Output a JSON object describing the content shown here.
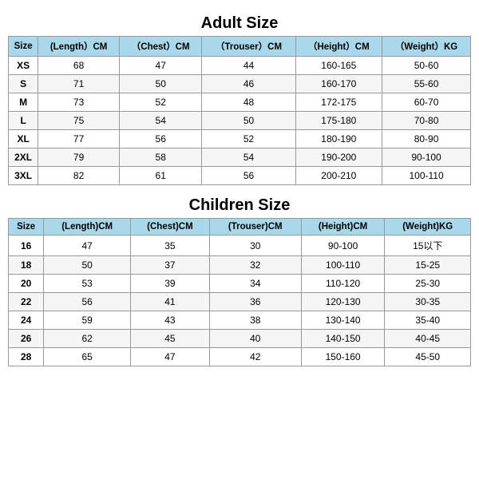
{
  "adult": {
    "title": "Adult Size",
    "headers": [
      "Size",
      "(Length）CM",
      "（Chest）CM",
      "（Trouser）CM",
      "（Height）CM",
      "（Weight）KG"
    ],
    "rows": [
      [
        "XS",
        "68",
        "47",
        "44",
        "160-165",
        "50-60"
      ],
      [
        "S",
        "71",
        "50",
        "46",
        "160-170",
        "55-60"
      ],
      [
        "M",
        "73",
        "52",
        "48",
        "172-175",
        "60-70"
      ],
      [
        "L",
        "75",
        "54",
        "50",
        "175-180",
        "70-80"
      ],
      [
        "XL",
        "77",
        "56",
        "52",
        "180-190",
        "80-90"
      ],
      [
        "2XL",
        "79",
        "58",
        "54",
        "190-200",
        "90-100"
      ],
      [
        "3XL",
        "82",
        "61",
        "56",
        "200-210",
        "100-110"
      ]
    ]
  },
  "children": {
    "title": "Children Size",
    "headers": [
      "Size",
      "(Length)CM",
      "(Chest)CM",
      "(Trouser)CM",
      "(Height)CM",
      "(Weight)KG"
    ],
    "rows": [
      [
        "16",
        "47",
        "35",
        "30",
        "90-100",
        "15以下"
      ],
      [
        "18",
        "50",
        "37",
        "32",
        "100-110",
        "15-25"
      ],
      [
        "20",
        "53",
        "39",
        "34",
        "110-120",
        "25-30"
      ],
      [
        "22",
        "56",
        "41",
        "36",
        "120-130",
        "30-35"
      ],
      [
        "24",
        "59",
        "43",
        "38",
        "130-140",
        "35-40"
      ],
      [
        "26",
        "62",
        "45",
        "40",
        "140-150",
        "40-45"
      ],
      [
        "28",
        "65",
        "47",
        "42",
        "150-160",
        "45-50"
      ]
    ]
  }
}
